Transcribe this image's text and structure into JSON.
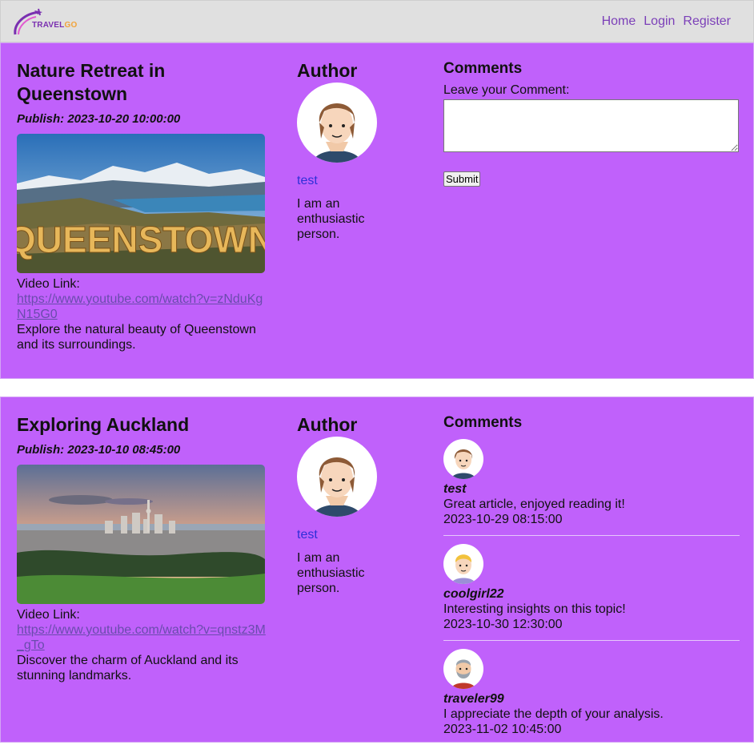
{
  "nav": {
    "logo_main": "TRAVEL",
    "logo_accent": "GO",
    "links": [
      "Home",
      "Login",
      "Register"
    ]
  },
  "posts": [
    {
      "title": "Nature Retreat in Queenstown",
      "publish": "Publish: 2023-10-20 10:00:00",
      "image_caption": "QUEENSTOWN",
      "video_label": "Video Link:",
      "video_url": "https://www.youtube.com/watch?v=zNduKgN15G0",
      "description": "Explore the natural beauty of Queenstown and its surroundings.",
      "author_heading": "Author",
      "author_name": "test",
      "author_bio": "I am an enthusiastic person.",
      "comments_heading": "Comments",
      "comment_label": "Leave your Comment:",
      "comment_value": "",
      "submit_label": "Submit"
    },
    {
      "title": "Exploring Auckland",
      "publish": "Publish: 2023-10-10 08:45:00",
      "video_label": "Video Link:",
      "video_url": "https://www.youtube.com/watch?v=qnstz3M_gTo",
      "description": "Discover the charm of Auckland and its stunning landmarks.",
      "author_heading": "Author",
      "author_name": "test",
      "author_bio": "I am an enthusiastic person.",
      "comments_heading": "Comments",
      "comments": [
        {
          "user": "test",
          "text": "Great article, enjoyed reading it!",
          "date": "2023-10-29 08:15:00"
        },
        {
          "user": "coolgirl22",
          "text": "Interesting insights on this topic!",
          "date": "2023-10-30 12:30:00"
        },
        {
          "user": "traveler99",
          "text": "I appreciate the depth of your analysis.",
          "date": "2023-11-02 10:45:00"
        }
      ]
    }
  ],
  "colors": {
    "post_bg": "#c061fb",
    "nav_bg": "#e0e0e0",
    "link": "#7b3fb8",
    "author_link": "#2f2fd8"
  }
}
